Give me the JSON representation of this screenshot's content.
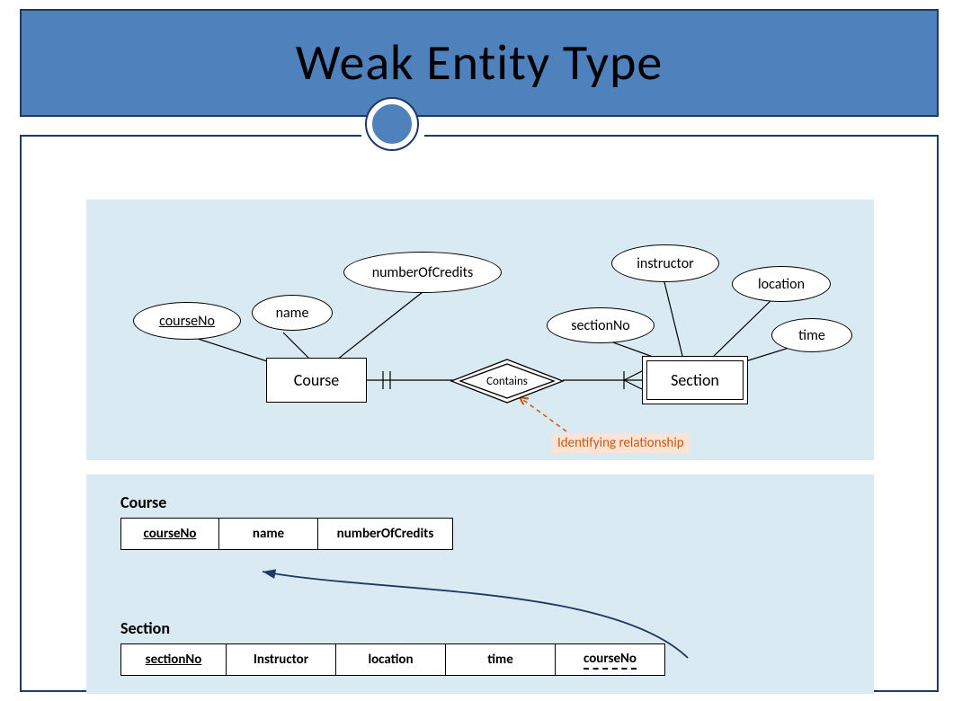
{
  "title": "Weak Entity Type",
  "er": {
    "entity1": "Course",
    "entity2": "Section",
    "relationship": "Contains",
    "attributes1": {
      "courseNo": "courseNo",
      "name": "name",
      "numberOfCredits": "numberOfCredits"
    },
    "attributes2": {
      "sectionNo": "sectionNo",
      "instructor": "instructor",
      "location": "location",
      "time": "time"
    },
    "callout": "Identifying relationship"
  },
  "schema": {
    "courseTitle": "Course",
    "courseCols": [
      "courseNo",
      "name",
      "numberOfCredits"
    ],
    "sectionTitle": "Section",
    "sectionCols": [
      "sectionNo",
      "Instructor",
      "location",
      "time",
      "courseNo"
    ]
  }
}
